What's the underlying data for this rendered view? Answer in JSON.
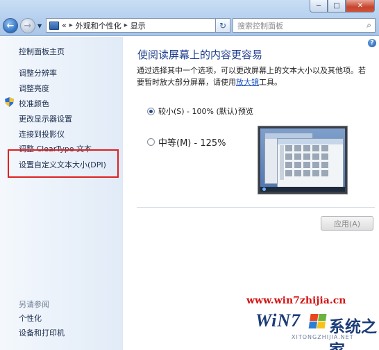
{
  "window": {
    "btn_min": "─",
    "btn_max": "□",
    "btn_close": "✕"
  },
  "nav": {
    "back_glyph": "←",
    "fwd_glyph": "→",
    "drop_glyph": "▼"
  },
  "address": {
    "prefix": "«",
    "crumb1": "外观和个性化",
    "crumb2": "显示",
    "separator": "▸",
    "drop_glyph": "▼"
  },
  "refresh_glyph": "↻",
  "search": {
    "placeholder": "搜索控制面板",
    "icon_glyph": "⌕"
  },
  "sidebar": {
    "home": "控制面板主页",
    "items": [
      "调整分辨率",
      "调整亮度",
      "校准颜色",
      "更改显示器设置",
      "连接到投影仪",
      "调整 ClearType 文本",
      "设置自定义文本大小(DPI)"
    ],
    "see_also_title": "另请参阅",
    "see_also": [
      "个性化",
      "设备和打印机"
    ]
  },
  "main": {
    "help_glyph": "?",
    "title": "使阅读屏幕上的内容更容易",
    "desc_part1": "通过选择其中一个选项，可以更改屏幕上的文本大小以及其他项。若要暂时放大部分屏幕，请使用",
    "desc_link": "放大镜",
    "desc_part2": "工具。",
    "option_small": "较小(S) - 100% (默认)",
    "option_medium": "中等(M) - 125%",
    "selected_option": "small",
    "preview_label": "预览",
    "apply_label": "应用(A)"
  },
  "watermark": {
    "url": "www.win7zhijia.cn",
    "logo": "WiN7",
    "cn": "系统之家",
    "sub": "XITONGZHIJIA.NET"
  },
  "colors": {
    "title": "#1f3f8f",
    "link": "#1a55c4",
    "highlight_box": "#e02020",
    "watermark_url": "#d41414"
  }
}
